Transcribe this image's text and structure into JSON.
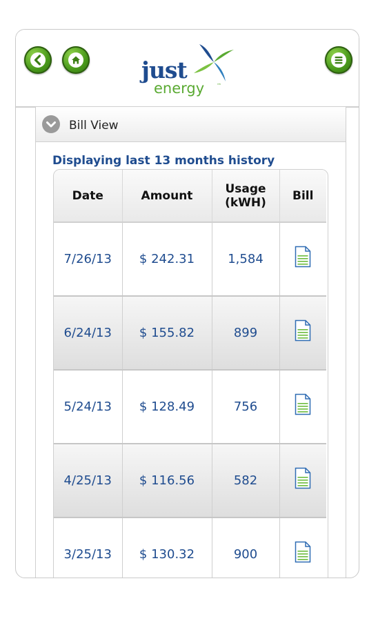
{
  "header": {
    "logo_primary": "just",
    "logo_secondary": "energy",
    "logo_mark": "™",
    "icons": [
      "back-arrow-icon",
      "home-icon",
      "menu-icon"
    ],
    "accent_color": "#4a9a1c"
  },
  "section": {
    "title": "Bill View",
    "icon": "chevron-down-icon"
  },
  "history_label": "Displaying last 13 months history",
  "table": {
    "headers": {
      "date": "Date",
      "amount": "Amount",
      "usage_line1": "Usage",
      "usage_line2": "(kWH)",
      "bill": "Bill"
    },
    "rows": [
      {
        "date": "7/26/13",
        "amount": "$ 242.31",
        "usage": "1,584",
        "bill_icon": "document-icon"
      },
      {
        "date": "6/24/13",
        "amount": "$ 155.82",
        "usage": "899",
        "bill_icon": "document-icon"
      },
      {
        "date": "5/24/13",
        "amount": "$ 128.49",
        "usage": "756",
        "bill_icon": "document-icon"
      },
      {
        "date": "4/25/13",
        "amount": "$ 116.56",
        "usage": "582",
        "bill_icon": "document-icon"
      },
      {
        "date": "3/25/13",
        "amount": "$ 130.32",
        "usage": "900",
        "bill_icon": "document-icon"
      }
    ]
  },
  "colors": {
    "text_blue": "#1f4c8f",
    "logo_green": "#5aaa32"
  }
}
